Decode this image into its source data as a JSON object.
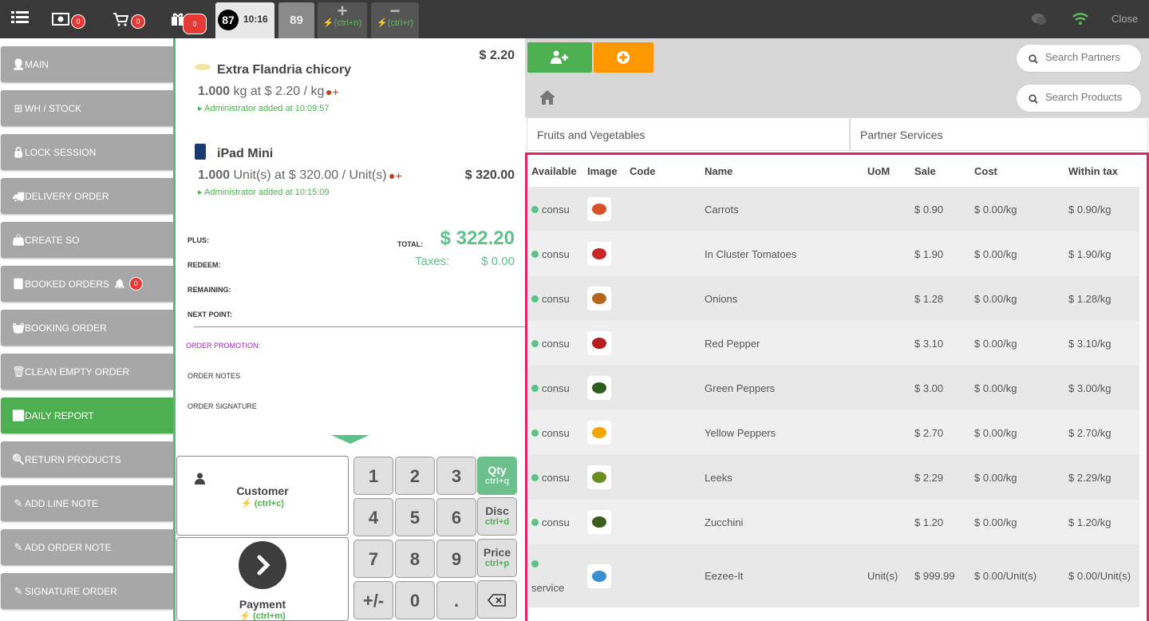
{
  "topbar": {
    "cash_badge": "0",
    "cart_badge": "0",
    "gift_badge": "0",
    "order_num": "87",
    "order_time": "10:16",
    "order2_num": "89",
    "add_shortcut": "(ctrl+n)",
    "remove_shortcut": "(ctrl+r)",
    "close_label": "Close"
  },
  "sidebar": {
    "items": [
      {
        "label": "MAIN",
        "icon": "user-icon"
      },
      {
        "label": "WH / STOCK",
        "icon": "sitemap-icon"
      },
      {
        "label": "LOCK SESSION",
        "icon": "lock-icon"
      },
      {
        "label": "DELIVERY ORDER",
        "icon": "truck-icon"
      },
      {
        "label": "CREATE SO",
        "icon": "bag-icon"
      },
      {
        "label": "BOOKED ORDERS",
        "icon": "book-icon",
        "badge": "0"
      },
      {
        "label": "BOOKING ORDER",
        "icon": "basket-icon"
      },
      {
        "label": "CLEAN EMPTY ORDER",
        "icon": "trash-icon"
      },
      {
        "label": "DAILY REPORT",
        "icon": "signal-icon"
      },
      {
        "label": "RETURN PRODUCTS",
        "icon": "search-icon"
      },
      {
        "label": "ADD LINE NOTE",
        "icon": "edit-icon"
      },
      {
        "label": "ADD ORDER NOTE",
        "icon": "edit-icon"
      },
      {
        "label": "SIGNATURE ORDER",
        "icon": "edit-icon"
      }
    ]
  },
  "order": {
    "lines": [
      {
        "name": "Extra Flandria chicory",
        "qty": "1.000",
        "detail": "kg at $ 2.20 / kg",
        "price": "$ 2.20",
        "note": "Administrator added at 10:09:57"
      },
      {
        "name": "iPad Mini",
        "qty": "1.000",
        "detail": "Unit(s) at $ 320.00 / Unit(s)",
        "price": "$ 320.00",
        "note": "Administrator added at 10:15:09"
      }
    ],
    "plus_label": "PLUS:",
    "redeem_label": "REDEEM:",
    "remaining_label": "REMAINING:",
    "next_point_label": "NEXT POINT:",
    "total_label": "TOTAL:",
    "total_value": "$ 322.20",
    "taxes_label": "Taxes:",
    "taxes_value": "$ 0.00",
    "promotion_label": "ORDER PROMOTION:",
    "notes_label": "ORDER NOTES",
    "signature_label": "ORDER SIGNATURE"
  },
  "pad": {
    "customer_label": "Customer",
    "customer_shortcut": "(ctrl+c)",
    "payment_label": "Payment",
    "payment_shortcut": "(ctrl+m)",
    "keys": [
      "1",
      "2",
      "3",
      "4",
      "5",
      "6",
      "7",
      "8",
      "9",
      "+/-",
      "0",
      "."
    ],
    "qty_label": "Qty",
    "qty_shortcut": "ctrl+q",
    "disc_label": "Disc",
    "disc_shortcut": "ctrl+d",
    "price_label": "Price",
    "price_shortcut": "ctrl+p"
  },
  "products": {
    "search_partners_placeholder": "Search Partners",
    "search_products_placeholder": "Search Products",
    "categories": [
      "Fruits and Vegetables",
      "Partner Services"
    ],
    "columns": [
      "Available",
      "Image",
      "Code",
      "Name",
      "UoM",
      "Sale",
      "Cost",
      "Within tax"
    ],
    "rows": [
      {
        "available": "consu",
        "name": "Carrots",
        "uom": "",
        "sale": "$ 0.90",
        "cost": "$ 0.00/kg",
        "tax": "$ 0.90/kg",
        "color": "#d9532a"
      },
      {
        "available": "consu",
        "name": "In Cluster Tomatoes",
        "uom": "",
        "sale": "$ 1.90",
        "cost": "$ 0.00/kg",
        "tax": "$ 1.90/kg",
        "color": "#c62828"
      },
      {
        "available": "consu",
        "name": "Onions",
        "uom": "",
        "sale": "$ 1.28",
        "cost": "$ 0.00/kg",
        "tax": "$ 1.28/kg",
        "color": "#b5651d"
      },
      {
        "available": "consu",
        "name": "Red Pepper",
        "uom": "",
        "sale": "$ 3.10",
        "cost": "$ 0.00/kg",
        "tax": "$ 3.10/kg",
        "color": "#b71c1c"
      },
      {
        "available": "consu",
        "name": "Green Peppers",
        "uom": "",
        "sale": "$ 3.00",
        "cost": "$ 0.00/kg",
        "tax": "$ 3.00/kg",
        "color": "#2e5d1e"
      },
      {
        "available": "consu",
        "name": "Yellow Peppers",
        "uom": "",
        "sale": "$ 2.70",
        "cost": "$ 0.00/kg",
        "tax": "$ 2.70/kg",
        "color": "#f0a500"
      },
      {
        "available": "consu",
        "name": "Leeks",
        "uom": "",
        "sale": "$ 2.29",
        "cost": "$ 0.00/kg",
        "tax": "$ 2.29/kg",
        "color": "#6b8e23"
      },
      {
        "available": "consu",
        "name": "Zucchini",
        "uom": "",
        "sale": "$ 1.20",
        "cost": "$ 0.00/kg",
        "tax": "$ 1.20/kg",
        "color": "#3b5d1a"
      },
      {
        "available": "service",
        "name": "Eezee-It",
        "uom": "Unit(s)",
        "sale": "$ 999.99",
        "cost": "$ 0.00/Unit(s)",
        "tax": "$ 0.00/Unit(s)",
        "color": "#3a8fd0"
      }
    ]
  },
  "colors": {
    "accent": "#4caf50",
    "highlight": "#e91e63",
    "orange": "#ff9800"
  }
}
